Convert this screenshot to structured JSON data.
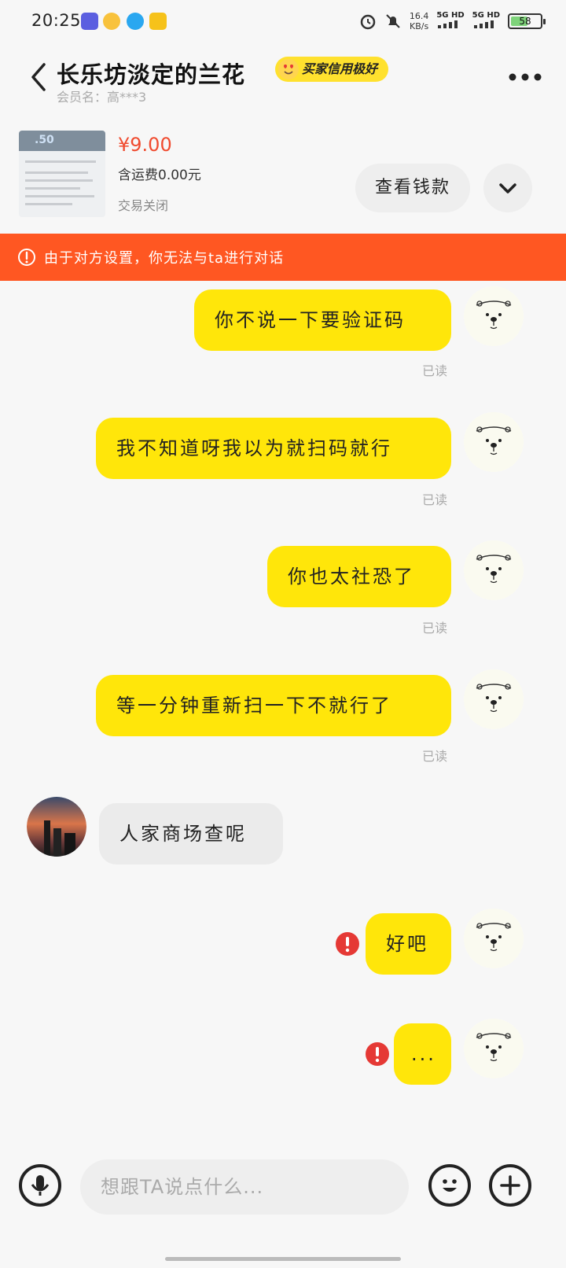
{
  "status_bar": {
    "time": "20:25",
    "net_speed_value": "16.4",
    "net_speed_unit": "KB/s",
    "signal_1": "5G HD",
    "signal_2": "5G HD",
    "battery": "58",
    "battery_level": 0.58
  },
  "header": {
    "title": "长乐坊淡定的兰花",
    "credit_badge": "买家信用极好",
    "member": "会员名：高***3"
  },
  "product": {
    "thumb_number": ".50",
    "price": "¥9.00",
    "shipping": "含运费0.00元",
    "status": "交易关闭",
    "view_money_button": "查看钱款"
  },
  "banner": {
    "text": "由于对方设置，你无法与ta进行对话"
  },
  "messages": [
    {
      "sender": "me",
      "text": "你不说一下要验证码",
      "read": "已读"
    },
    {
      "sender": "me",
      "text": "我不知道呀我以为就扫码就行",
      "read": "已读"
    },
    {
      "sender": "me",
      "text": "你也太社恐了",
      "read": "已读"
    },
    {
      "sender": "me",
      "text": "等一分钟重新扫一下不就行了",
      "read": "已读"
    },
    {
      "sender": "other",
      "text": "人家商场查呢"
    },
    {
      "sender": "me",
      "text": "好吧",
      "failed": true
    },
    {
      "sender": "me",
      "text": "...",
      "failed": true
    }
  ],
  "composer": {
    "placeholder": "想跟TA说点什么..."
  },
  "colors": {
    "accent_yellow": "#ffe60a",
    "banner_orange": "#ff5722",
    "price_red": "#f04a2e",
    "error_red": "#e53935"
  }
}
